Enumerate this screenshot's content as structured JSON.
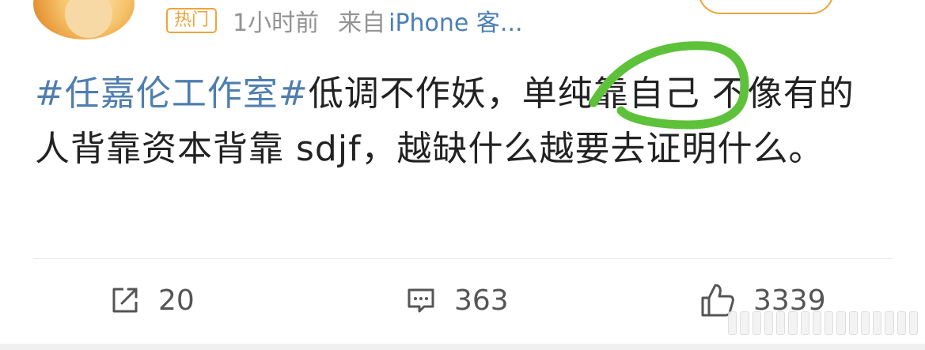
{
  "post": {
    "badge": "热门",
    "time": "1小时前",
    "source_prefix": "来自",
    "source": "iPhone 客...",
    "text_segments": [
      {
        "type": "topic",
        "text": "#任嘉伦工作室#"
      },
      {
        "type": "text",
        "text": "低调不作妖，单纯靠自己  不像有的人背靠资本背靠 sdjf，越缺什么越要去证明什么。"
      }
    ]
  },
  "actions": {
    "repost_count": "20",
    "comment_count": "363",
    "like_count": "3339"
  },
  "colors": {
    "topic": "#4f7eb0",
    "badge": "#f0a33a",
    "annotation": "#5dc13a"
  },
  "icons": [
    "repost-icon",
    "comment-icon",
    "like-icon"
  ]
}
